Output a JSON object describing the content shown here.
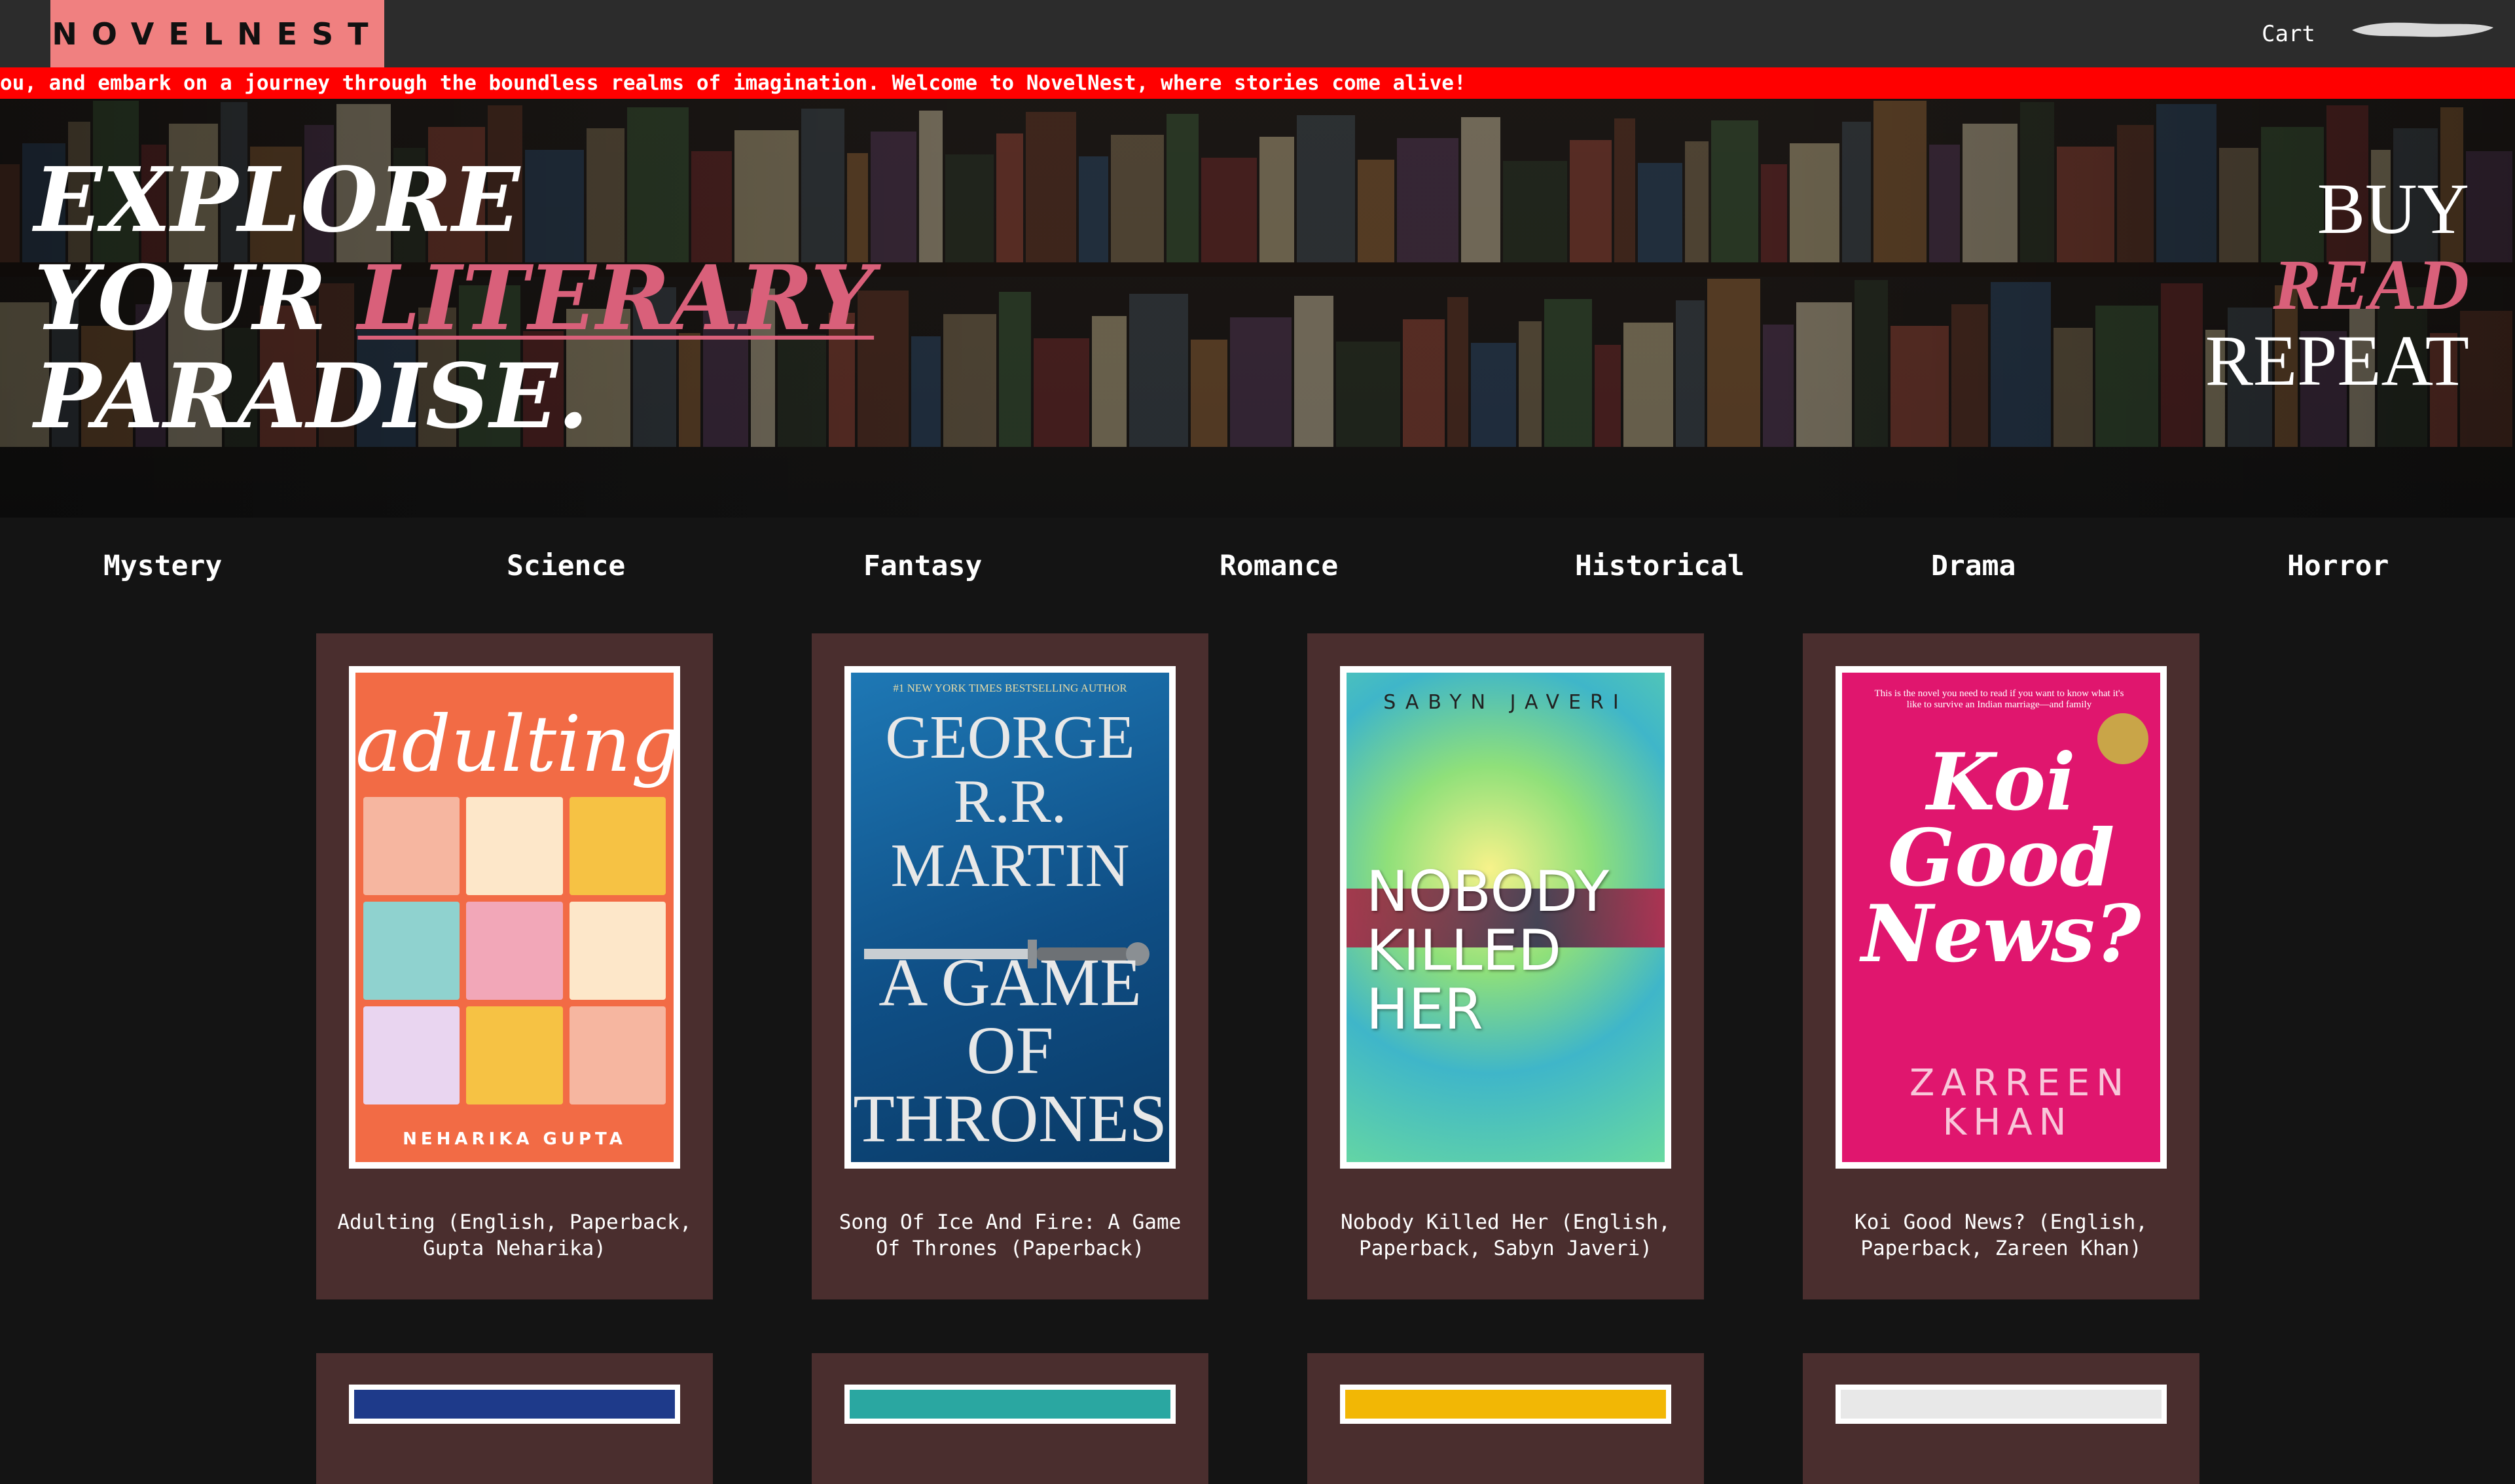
{
  "nav": {
    "logo": "NOVELNEST",
    "cart_label": "Cart"
  },
  "marquee": {
    "text": "ou, and embark on a journey through the boundless realms of imagination. Welcome to NovelNest, where stories come alive!"
  },
  "hero": {
    "line1": "EXPLORE",
    "line2_prefix": "YOUR ",
    "line2_accent": "LITERARY",
    "line3": "PARADISE.",
    "slogan": [
      "BUY",
      "READ",
      "REPEAT"
    ]
  },
  "categories": [
    "Mystery",
    "Science",
    "Fantasy",
    "Romance",
    "Historical",
    "Drama",
    "Horror"
  ],
  "books": [
    {
      "title": "Adulting (English, Paperback, Gupta Neharika)",
      "cover_title": "adulting",
      "cover_author": "NEHARIKA GUPTA"
    },
    {
      "title": "Song Of Ice And Fire: A Game Of Thrones (Paperback)",
      "cover_tag": "#1 NEW YORK TIMES BESTSELLING AUTHOR",
      "cover_author": "GEORGE R.R. MARTIN",
      "cover_title": "A GAME OF THRONES"
    },
    {
      "title": "Nobody Killed Her (English, Paperback, Sabyn Javeri)",
      "cover_author": "SABYN JAVERI",
      "cover_title": "NOBODY KILLED HER"
    },
    {
      "title": "Koi Good News? (English, Paperback, Zareen Khan)",
      "cover_quote": "This is the novel you need to read if you want to know what it's like to survive an Indian marriage—and family",
      "cover_title": "Koi Good News?",
      "cover_author": "ZARREEN KHAN"
    }
  ],
  "colors": {
    "nav_bg": "#2c2c2c",
    "logo_bg": "#f08080",
    "marquee_bg": "#ff0000",
    "accent": "#d9607a",
    "card_bg": "#4a2e2e",
    "page_bg": "#141414"
  }
}
